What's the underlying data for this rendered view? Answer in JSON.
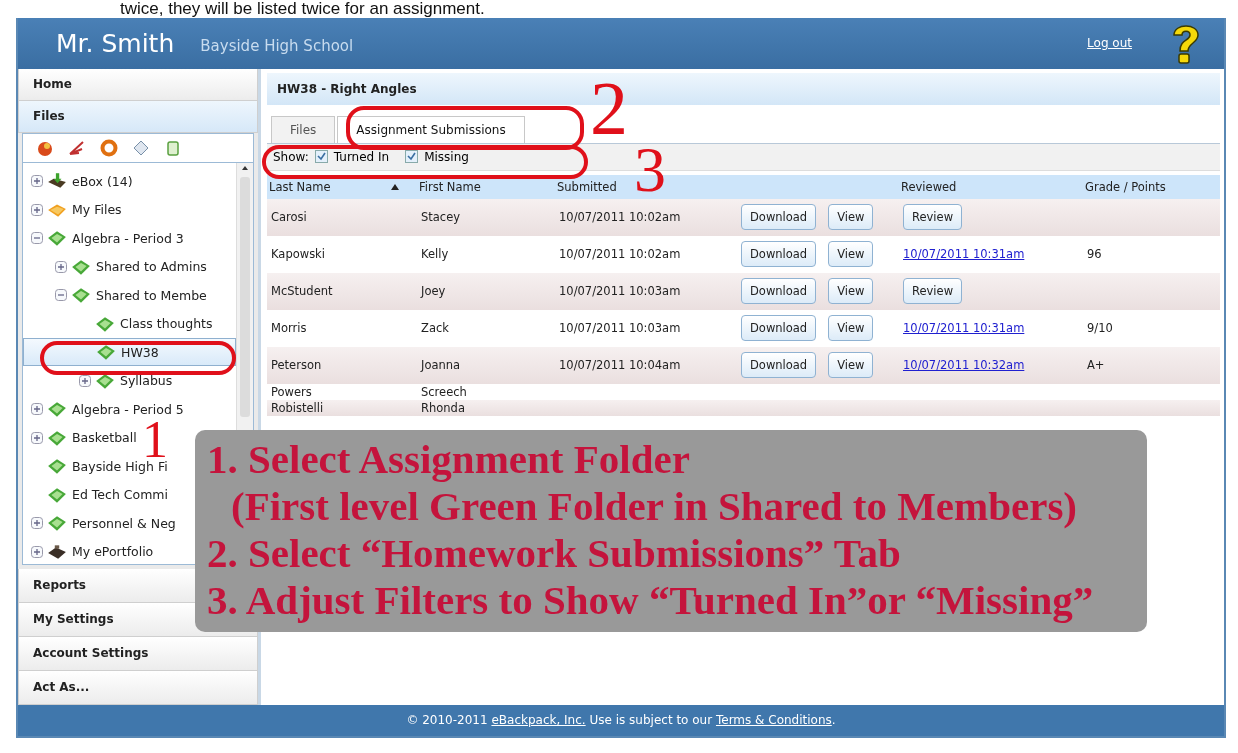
{
  "caption": "twice, they will be listed twice for an assignment.",
  "header": {
    "teacher": "Mr. Smith",
    "school": "Bayside High School",
    "logout": "Log out"
  },
  "sidebar": {
    "top_items": [
      {
        "label": "Home",
        "selected": false
      },
      {
        "label": "Files",
        "selected": true
      }
    ],
    "tree": [
      {
        "label": "eBox (14)",
        "kind": "inbox",
        "selected": false,
        "expanded": false
      },
      {
        "label": "My Files",
        "kind": "orange-folder",
        "selected": false,
        "expanded": false
      },
      {
        "label": "Algebra - Period 3",
        "kind": "green-folder",
        "selected": false,
        "expanded": true,
        "children": [
          {
            "label": "Shared to Admins",
            "kind": "green-folder",
            "selected": false,
            "expanded": false
          },
          {
            "label": "Shared to Membe",
            "kind": "green-folder",
            "selected": false,
            "expanded": true,
            "children": [
              {
                "label": "Class thoughts",
                "kind": "green-folder",
                "selected": false
              },
              {
                "label": "HW38",
                "kind": "green-folder",
                "selected": true
              },
              {
                "label": "Syllabus",
                "kind": "green-folder",
                "selected": false,
                "expanded": false
              }
            ]
          }
        ]
      },
      {
        "label": "Algebra - Period 5",
        "kind": "green-folder",
        "selected": false,
        "expanded": false
      },
      {
        "label": "Basketball",
        "kind": "green-folder",
        "selected": false,
        "expanded": false
      },
      {
        "label": "Bayside High Fi",
        "kind": "green-folder",
        "selected": false
      },
      {
        "label": "Ed Tech Commi",
        "kind": "green-folder",
        "selected": false
      },
      {
        "label": "Personnel & Neg",
        "kind": "green-folder",
        "selected": false,
        "expanded": false
      },
      {
        "label": "My ePortfolio",
        "kind": "portfolio",
        "selected": false,
        "expanded": false
      }
    ],
    "bottom_items": [
      {
        "label": "Reports"
      },
      {
        "label": "My Settings"
      },
      {
        "label": "Account Settings"
      },
      {
        "label": "Act As..."
      }
    ]
  },
  "content": {
    "title": "HW38 - Right Angles",
    "tabs": [
      {
        "label": "Files",
        "selected": false
      },
      {
        "label": "Assignment Submissions",
        "selected": true
      }
    ],
    "filter": {
      "label": "Show:",
      "options": [
        {
          "label": "Turned In",
          "checked": true
        },
        {
          "label": "Missing",
          "checked": true
        }
      ]
    },
    "table": {
      "columns": [
        "Last Name",
        "First Name",
        "Submitted",
        "Reviewed",
        "Grade / Points"
      ],
      "rows": [
        {
          "last": "Carosi",
          "first": "Stacey",
          "submitted": "10/07/2011 10:02am",
          "actions": [
            "Download",
            "View"
          ],
          "review": {
            "kind": "button",
            "label": "Review"
          }
        },
        {
          "last": "Kapowski",
          "first": "Kelly",
          "submitted": "10/07/2011 10:02am",
          "actions": [
            "Download",
            "View"
          ],
          "review": {
            "kind": "link",
            "label": "10/07/2011 10:31am"
          },
          "grade": "96"
        },
        {
          "last": "McStudent",
          "first": "Joey",
          "submitted": "10/07/2011 10:03am",
          "actions": [
            "Download",
            "View"
          ],
          "review": {
            "kind": "button",
            "label": "Review"
          }
        },
        {
          "last": "Morris",
          "first": "Zack",
          "submitted": "10/07/2011 10:03am",
          "actions": [
            "Download",
            "View"
          ],
          "review": {
            "kind": "link",
            "label": "10/07/2011 10:31am"
          },
          "grade": "9/10"
        },
        {
          "last": "Peterson",
          "first": "Joanna",
          "submitted": "10/07/2011 10:04am",
          "actions": [
            "Download",
            "View"
          ],
          "review": {
            "kind": "link",
            "label": "10/07/2011 10:32am"
          },
          "grade": "A+"
        },
        {
          "last": "Powers",
          "first": "Screech"
        },
        {
          "last": "Robistelli",
          "first": "Rhonda"
        }
      ]
    }
  },
  "footer": [
    {
      "kind": "text",
      "text": "© 2010-2011 "
    },
    {
      "kind": "link",
      "text": "eBackpack, Inc."
    },
    {
      "kind": "text",
      "text": " Use is subject to our "
    },
    {
      "kind": "link",
      "text": "Terms & Conditions"
    },
    {
      "kind": "text",
      "text": "."
    }
  ],
  "annotations": {
    "markers": [
      "1",
      "2",
      "3"
    ],
    "instructions": [
      "1. Select Assignment Folder",
      "(First level Green Folder in Shared to Members)",
      "2. Select “Homework Submissions” Tab",
      "3. Adjust Filters to Show “Turned In”or “Missing”"
    ]
  }
}
